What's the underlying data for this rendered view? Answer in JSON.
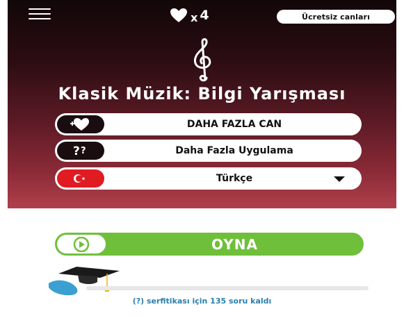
{
  "header": {
    "lives_multiplier": "x",
    "lives_count": "4",
    "free_lives_label": "Ücretsiz canları"
  },
  "app": {
    "title": "Klasik Müzik: Bilgi Yarışması"
  },
  "buttons": {
    "more_lives": "DAHA FAZLA CAN",
    "more_apps": "Daha Fazla Uygulama",
    "language": "Türkçe",
    "play": "OYNA"
  },
  "certificate": {
    "text": "(?) serfitikası için 135 soru kaldı",
    "progress_fraction": 0
  },
  "colors": {
    "panel_top": "#120708",
    "panel_bottom": "#b0404b",
    "play_green": "#6fbf3a",
    "flag_red": "#e11b22",
    "text_blue": "#2a7fb0"
  },
  "icons": [
    "menu-icon",
    "heart-icon",
    "treble-clef-icon",
    "heart-plus-icon",
    "question-icon",
    "turkey-flag-icon",
    "chevron-down-icon",
    "play-icon",
    "graduation-cap-icon"
  ]
}
